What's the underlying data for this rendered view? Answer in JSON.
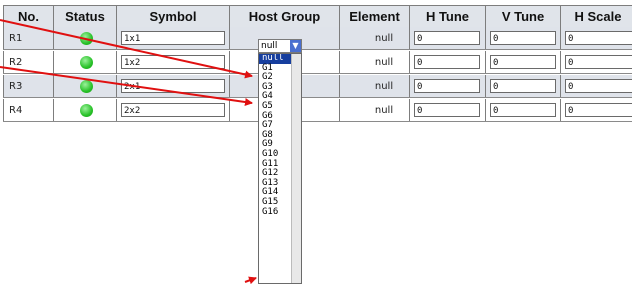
{
  "headers": [
    "No.",
    "Status",
    "Symbol",
    "Host Group",
    "Element",
    "H Tune",
    "V Tune",
    "H Scale"
  ],
  "rows": [
    {
      "no": "R1",
      "symbol": "1x1",
      "host": "null",
      "element": "null",
      "htune": "0",
      "vtune": "0",
      "hscale": "0"
    },
    {
      "no": "R2",
      "symbol": "1x2",
      "host": "",
      "element": "null",
      "htune": "0",
      "vtune": "0",
      "hscale": "0"
    },
    {
      "no": "R3",
      "symbol": "2x1",
      "host": "",
      "element": "null",
      "htune": "0",
      "vtune": "0",
      "hscale": "0"
    },
    {
      "no": "R4",
      "symbol": "2x2",
      "host": "",
      "element": "null",
      "htune": "0",
      "vtune": "0",
      "hscale": "0"
    }
  ],
  "dropdown": {
    "selected": "null",
    "options": [
      "null",
      "G1",
      "G2",
      "G3",
      "G4",
      "G5",
      "G6",
      "G7",
      "G8",
      "G9",
      "G10",
      "G11",
      "G12",
      "G13",
      "G14",
      "G15",
      "G16"
    ]
  },
  "colors": {
    "arrow": "#e01010",
    "status": "#2ac42a",
    "selected_option": "#163e9e"
  }
}
